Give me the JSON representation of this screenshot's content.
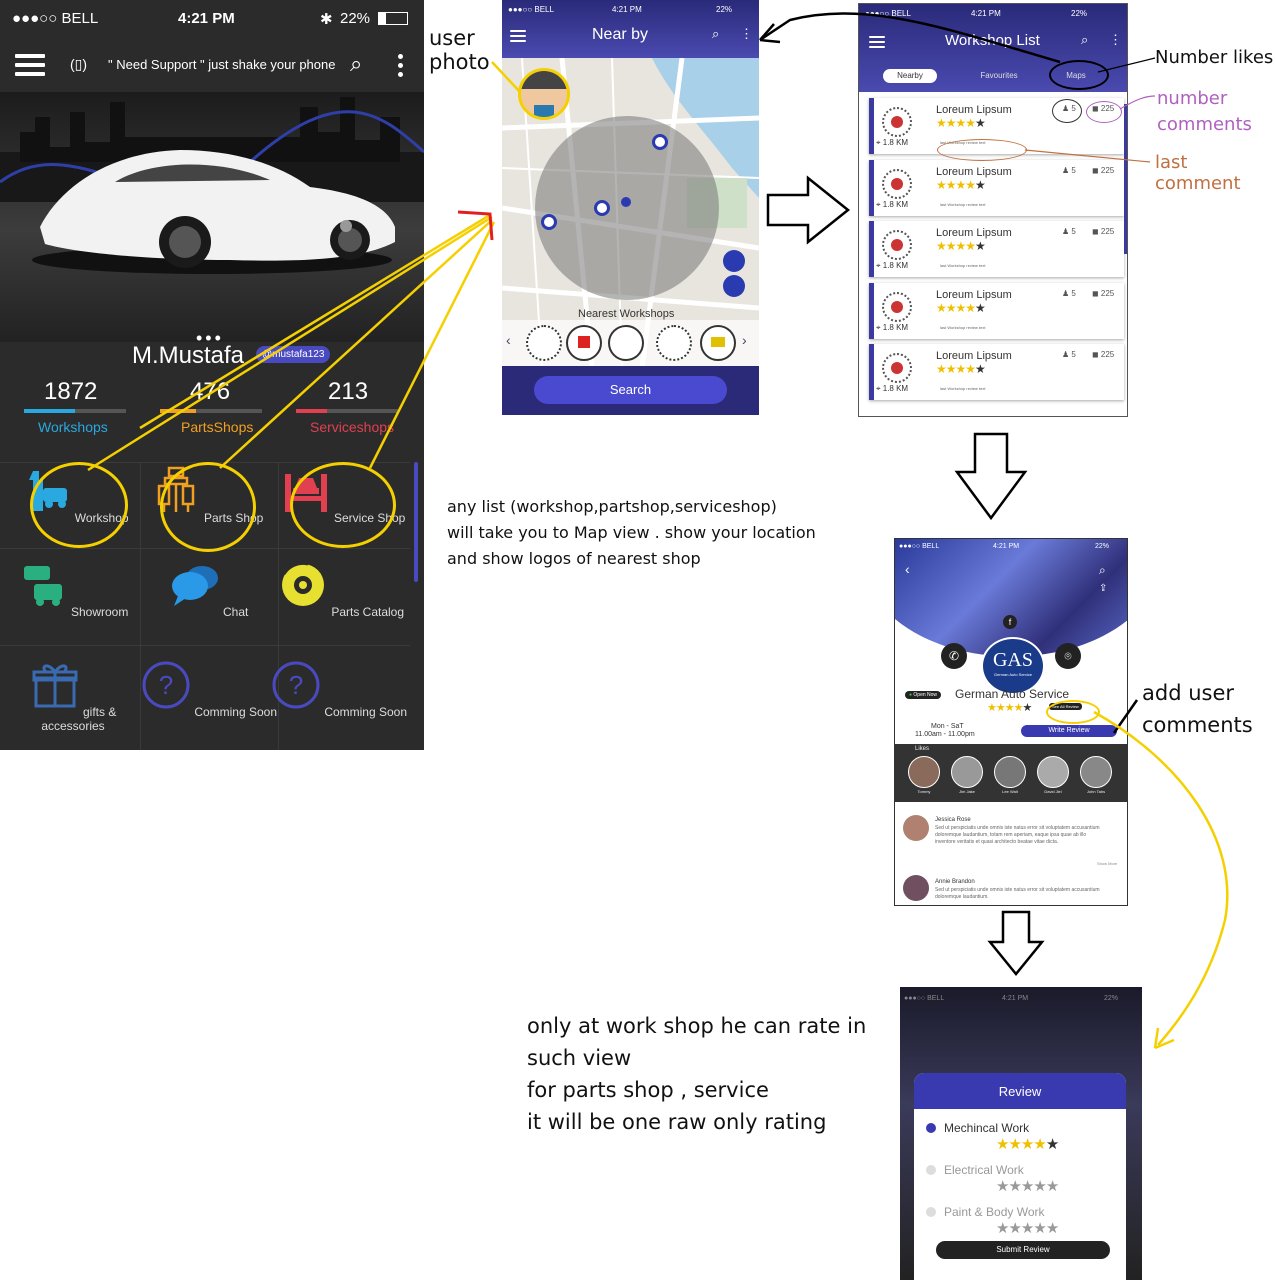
{
  "home": {
    "status": {
      "carrier": "●●●○○ BELL",
      "time": "4:21 PM",
      "battery": "22%"
    },
    "support_text": "\" Need Support \" just shake your phone",
    "user_name": "M.Mustafa",
    "user_handle": "@mustafa123",
    "stats": [
      {
        "value": "1872",
        "label": "Workshops",
        "color": "#2aa8e0",
        "fill": 0.5
      },
      {
        "value": "476",
        "label": "PartsShops",
        "color": "#f0a020",
        "fill": 0.35
      },
      {
        "value": "213",
        "label": "Serviceshops",
        "color": "#e04050",
        "fill": 0.3
      }
    ],
    "grid": [
      {
        "label": "Workshop"
      },
      {
        "label": "Parts Shop"
      },
      {
        "label": "Service Shop"
      },
      {
        "label": "Showroom"
      },
      {
        "label": "Chat"
      },
      {
        "label": "Parts Catalog"
      },
      {
        "label": "gifts & accessories"
      },
      {
        "label": "Comming Soon"
      },
      {
        "label": "Comming Soon"
      }
    ]
  },
  "map": {
    "status": {
      "carrier": "●●●○○ BELL",
      "time": "4:21 PM",
      "battery": "22%"
    },
    "title": "Near by",
    "nearest_label": "Nearest Workshops",
    "search_button": "Search"
  },
  "list": {
    "status": {
      "carrier": "●●●○○ BELL",
      "time": "4:21 PM",
      "battery": "22%"
    },
    "title": "Workshop List",
    "tabs": [
      "Nearby",
      "Favourites",
      "Maps"
    ],
    "items": [
      {
        "name": "Loreum Lipsum",
        "km": "1.8 KM",
        "likes": "5",
        "comments": "225"
      },
      {
        "name": "Loreum Lipsum",
        "km": "1.8 KM",
        "likes": "5",
        "comments": "225"
      },
      {
        "name": "Loreum Lipsum",
        "km": "1.8 KM",
        "likes": "5",
        "comments": "225"
      },
      {
        "name": "Loreum Lipsum",
        "km": "1.8 KM",
        "likes": "5",
        "comments": "225"
      },
      {
        "name": "Loreum Lipsum",
        "km": "1.8 KM",
        "likes": "5",
        "comments": "225"
      }
    ],
    "last_comment_preview": "last Workshop review text"
  },
  "profile": {
    "status": {
      "carrier": "●●●○○ BELL",
      "time": "4:21 PM",
      "battery": "22%"
    },
    "logo_text": "GAS",
    "logo_sub": "German Auto Service",
    "shop_name": "German Auto Service",
    "open_badge": "Open Now",
    "see_all_reviews": "See All Review",
    "hours_days": "Mon - SaT",
    "hours_time": "11.00am - 11.00pm",
    "write_review": "Write Review",
    "likes_label": "Likes",
    "likers": [
      "Tommy",
      "Jim Jake",
      "Lee Walt",
      "David Jiel",
      "John Tabs"
    ],
    "reviews": [
      {
        "name": "Jessica Rose",
        "text": "Sed ut perspiciatis unde omnis iste natus error sit voluptatem accusantium doloremque laudantium, totam rem aperiam, eaque ipsa quae ab illo inventore veritatis et quasi architecto beatae vitae dicta.",
        "more": "Show More"
      },
      {
        "name": "Annie Brandon",
        "text": "Sed ut perspiciatis unde omnis iste natus error sit voluptatem accusantium doloremque laudantium."
      }
    ]
  },
  "review": {
    "status": {
      "carrier": "●●●○○ BELL",
      "time": "4:21 PM",
      "battery": "22%"
    },
    "title": "Review",
    "rows": [
      {
        "label": "Mechincal Work",
        "rating": 4,
        "active": true
      },
      {
        "label": "Electrical Work",
        "rating": 0,
        "active": false
      },
      {
        "label": "Paint & Body Work",
        "rating": 0,
        "active": false
      }
    ],
    "submit": "Submit Review"
  },
  "annotations": {
    "user_photo_1": "user",
    "user_photo_2": "photo",
    "number_likes": "Number likes",
    "number_comments_1": "number",
    "number_comments_2": "comments",
    "last_comment": "last comment",
    "any_list_1": "any list (workshop,partshop,serviceshop)",
    "any_list_2": "will take you to  Map view . show your location",
    "any_list_3": "and show logos of nearest shop",
    "add_user_1": "add user",
    "add_user_2": "comments",
    "only_ws_1": "only at work shop he can rate in",
    "only_ws_2": "such view",
    "only_ws_3": "for parts shop , service",
    "only_ws_4": "it will be one raw only rating"
  }
}
